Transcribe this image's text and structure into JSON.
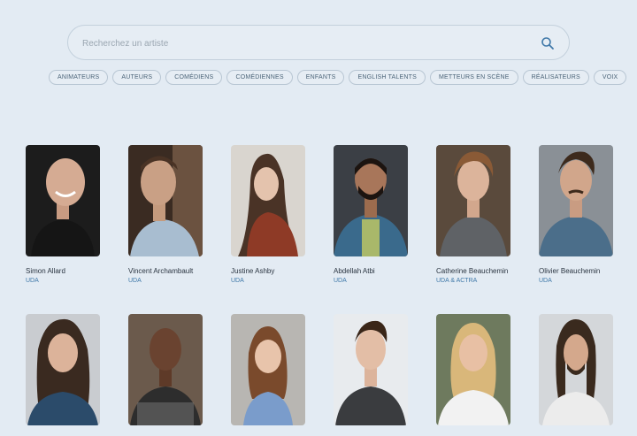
{
  "search": {
    "placeholder": "Recherchez un artiste",
    "icon": "search-icon"
  },
  "categories": [
    "ANIMATEURS",
    "AUTEURS",
    "COMÉDIENS",
    "COMÉDIENNES",
    "ENFANTS",
    "ENGLISH TALENTS",
    "METTEURS EN SCÈNE",
    "RÉALISATEURS",
    "VOIX"
  ],
  "artists": [
    {
      "name": "Simon Allard",
      "union": "UDA"
    },
    {
      "name": "Vincent Archambault",
      "union": "UDA"
    },
    {
      "name": "Justine Ashby",
      "union": "UDA"
    },
    {
      "name": "Abdellah Atbi",
      "union": "UDA"
    },
    {
      "name": "Catherine Beauchemin",
      "union": "UDA & ACTRA"
    },
    {
      "name": "Olivier Beauchemin",
      "union": "UDA"
    },
    {
      "name": "",
      "union": ""
    },
    {
      "name": "",
      "union": ""
    },
    {
      "name": "",
      "union": ""
    },
    {
      "name": "",
      "union": ""
    },
    {
      "name": "",
      "union": ""
    },
    {
      "name": "",
      "union": ""
    }
  ],
  "colors": {
    "background": "#e3ebf3",
    "accent": "#3f78a8"
  }
}
